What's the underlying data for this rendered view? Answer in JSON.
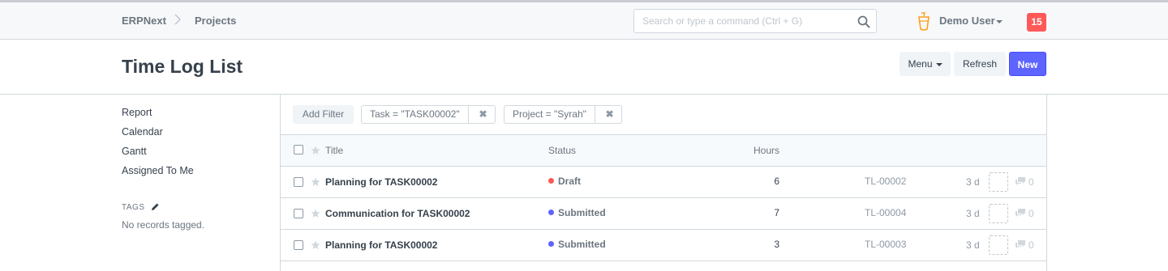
{
  "navbar": {
    "brand": "ERPNext",
    "breadcrumb": "Projects",
    "search_placeholder": "Search or type a command (Ctrl + G)",
    "user": "Demo User",
    "notifications": "15"
  },
  "page": {
    "title": "Time Log List",
    "menu_label": "Menu",
    "refresh_label": "Refresh",
    "new_label": "New"
  },
  "sidebar": {
    "links": [
      "Report",
      "Calendar",
      "Gantt",
      "Assigned To Me"
    ],
    "tags_label": "TAGS",
    "no_tags": "No records tagged."
  },
  "filters": {
    "add_label": "Add Filter",
    "items": [
      "Task = \"TASK00002\"",
      "Project = \"Syrah\""
    ]
  },
  "columns": {
    "title": "Title",
    "status": "Status",
    "hours": "Hours"
  },
  "rows": [
    {
      "title": "Planning for TASK00002",
      "status": "Draft",
      "status_color": "#ff5858",
      "hours": "6",
      "name": "TL-00002",
      "age": "3 d",
      "comments": "0"
    },
    {
      "title": "Communication for TASK00002",
      "status": "Submitted",
      "status_color": "#5e64ff",
      "hours": "7",
      "name": "TL-00004",
      "age": "3 d",
      "comments": "0"
    },
    {
      "title": "Planning for TASK00002",
      "status": "Submitted",
      "status_color": "#5e64ff",
      "hours": "3",
      "name": "TL-00003",
      "age": "3 d",
      "comments": "0"
    }
  ]
}
